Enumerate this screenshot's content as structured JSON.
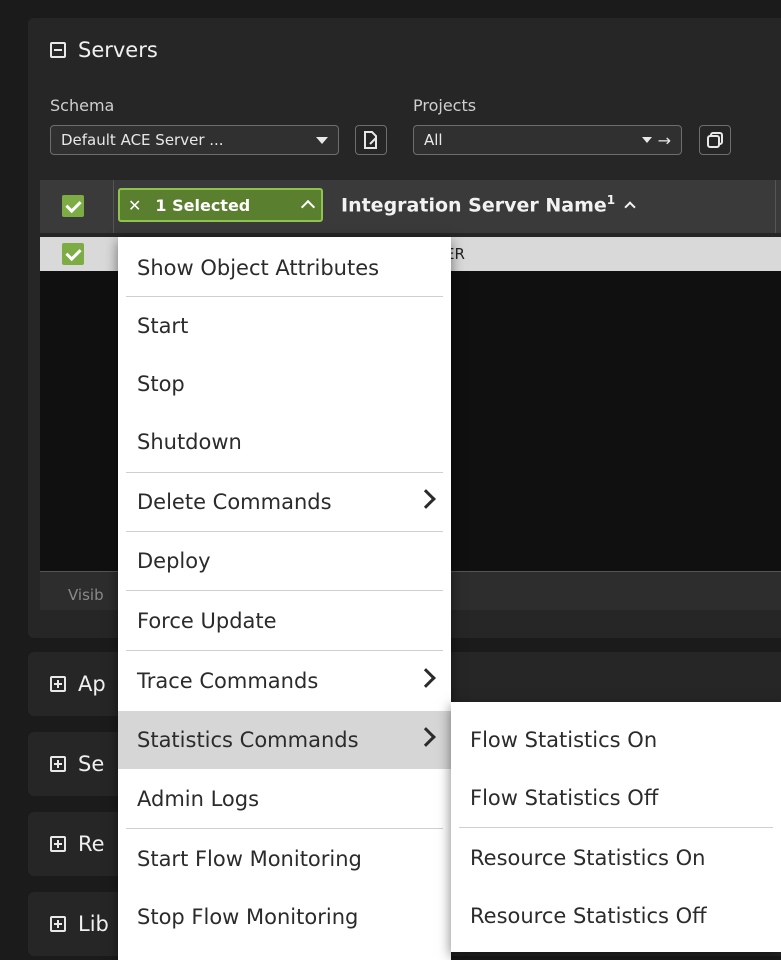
{
  "servers_section": {
    "title": "Servers",
    "schema_label": "Schema",
    "schema_value": "Default ACE Server ...",
    "projects_label": "Projects",
    "projects_value": "All",
    "selection_chip": "1 Selected",
    "column_header": "Integration Server Name",
    "column_sort_index": "1",
    "row_name_visible": "/ER",
    "footer_visible_text": "Visib"
  },
  "collapsed_sections": [
    {
      "title": "Ap"
    },
    {
      "title": "Se"
    },
    {
      "title": "Re"
    },
    {
      "title": "Lib"
    }
  ],
  "context_menu": {
    "items": [
      {
        "label": "Show Object Attributes"
      },
      {
        "label": "Start"
      },
      {
        "label": "Stop"
      },
      {
        "label": "Shutdown"
      },
      {
        "label": "Delete Commands"
      },
      {
        "label": "Deploy"
      },
      {
        "label": "Force Update"
      },
      {
        "label": "Trace Commands"
      },
      {
        "label": "Statistics Commands"
      },
      {
        "label": "Admin Logs"
      },
      {
        "label": "Start Flow Monitoring"
      },
      {
        "label": "Stop Flow Monitoring"
      }
    ]
  },
  "submenu": {
    "items": [
      {
        "label": "Flow Statistics On"
      },
      {
        "label": "Flow Statistics Off"
      },
      {
        "label": "Resource Statistics On"
      },
      {
        "label": "Resource Statistics Off"
      }
    ]
  },
  "colors": {
    "accent_green": "#7dac45",
    "background": "#1b1b1b",
    "panel": "#262626",
    "menu_highlight": "#d6d6d6"
  }
}
